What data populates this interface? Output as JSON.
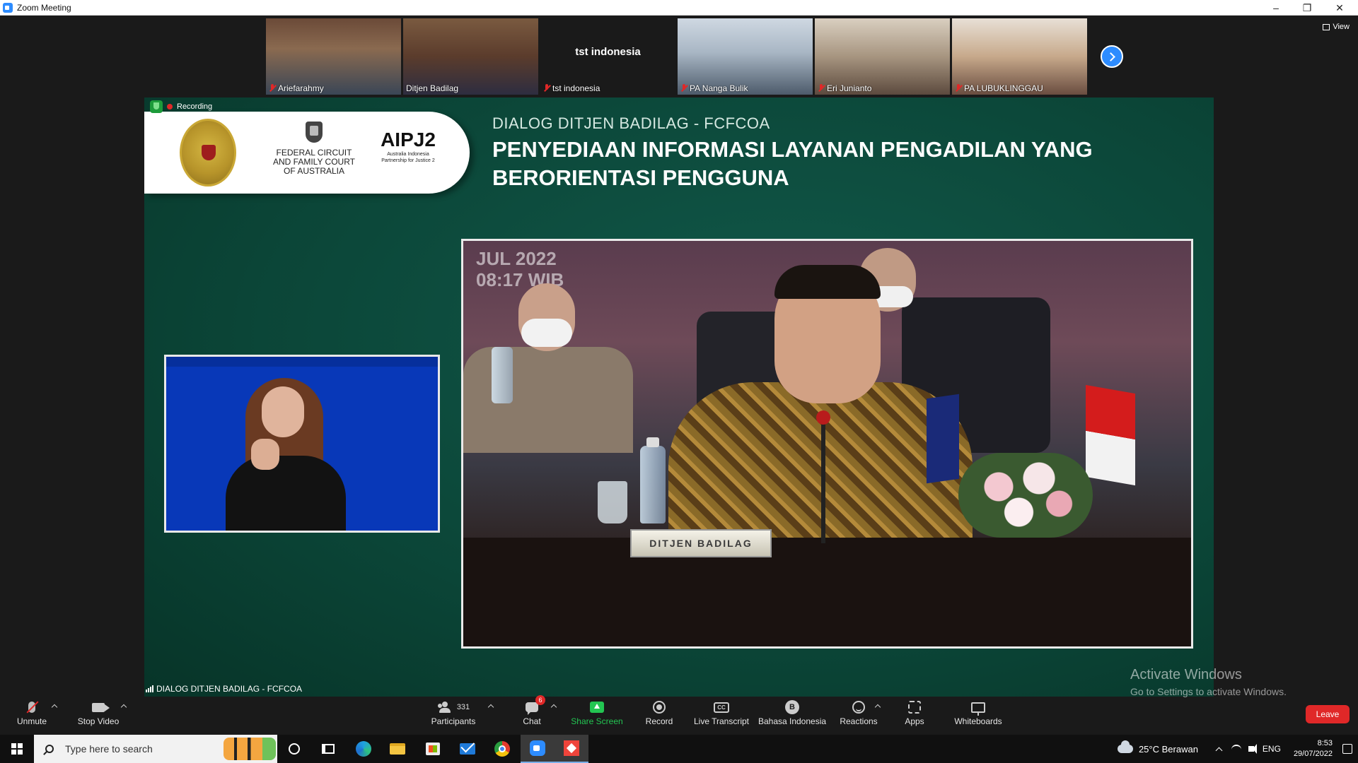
{
  "window": {
    "title": "Zoom Meeting",
    "minimize": "–",
    "restore": "❐",
    "close": "✕"
  },
  "thumbnails": [
    {
      "name": "Ariefarahmy",
      "muted": true
    },
    {
      "name": "Ditjen Badilag",
      "muted": false
    },
    {
      "name": "tst indonesia",
      "muted": true,
      "display_text": "tst indonesia"
    },
    {
      "name": "PA Nanga Bulik",
      "muted": true
    },
    {
      "name": "Eri Junianto",
      "muted": true
    },
    {
      "name": "PA LUBUKLINGGAU",
      "muted": true
    }
  ],
  "view_label": "View",
  "share": {
    "recording_label": "Recording",
    "logo_fcfca": "FEDERAL CIRCUIT AND FAMILY COURT OF AUSTRALIA",
    "logo_aipj": "AIPJ2",
    "logo_aipj_sub": "Australia Indonesia Partnership for Justice 2",
    "slide_subtitle": "DIALOG DITJEN BADILAG - FCFCOA",
    "slide_title": "PENYEDIAAN INFORMASI LAYANAN PENGADILAN YANG BERORIENTASI PENGGUNA",
    "video_date": "JUL 2022",
    "video_time": "08:17 WIB",
    "nameplate": "DITJEN BADILAG",
    "sharer_label": "DIALOG DITJEN BADILAG - FCFCOA"
  },
  "watermark": {
    "line1": "Activate Windows",
    "line2": "Go to Settings to activate Windows."
  },
  "toolbar": {
    "unmute": "Unmute",
    "stop_video": "Stop Video",
    "participants": "Participants",
    "participants_count": "331",
    "chat": "Chat",
    "chat_badge": "6",
    "share_screen": "Share Screen",
    "record": "Record",
    "live_transcript": "Live Transcript",
    "cc_glyph": "CC",
    "language": "Bahasa Indonesia",
    "language_glyph": "B",
    "reactions": "Reactions",
    "apps": "Apps",
    "whiteboards": "Whiteboards",
    "leave": "Leave"
  },
  "taskbar": {
    "search_placeholder": "Type here to search",
    "weather": "25°C  Berawan",
    "language": "ENG",
    "time": "8:53",
    "date": "29/07/2022"
  },
  "colors": {
    "zoom_blue": "#2d8cff",
    "share_green": "#23c552",
    "leave_red": "#e02828",
    "slide_bg": "#0c4a3a"
  }
}
